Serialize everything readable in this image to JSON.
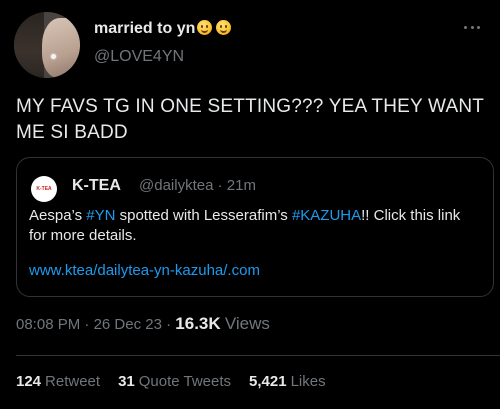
{
  "tweet": {
    "author": {
      "display_name": "married to yn",
      "emojis": [
        "hushed-face",
        "hushed-face"
      ],
      "handle": "@LOVE4YN"
    },
    "text": "MY FAVS TG IN ONE SETTING??? YEA THEY WANT ME SI BADD",
    "quoted": {
      "avatar_text": "K-TEA",
      "display_name": "K-TEA",
      "handle": "@dailyktea",
      "separator": "·",
      "time_ago": "21m",
      "body_parts": {
        "p1": "Aespa’s ",
        "tag1": "#YN",
        "p2": " spotted with Lesserafim’s ",
        "tag2": "#KAZUHA",
        "p3": "!! Click this link for more details."
      },
      "link": "www.ktea/dailytea-yn-kazuha/.com"
    },
    "meta": {
      "time": "08:08 PM",
      "date": "26 Dec 23",
      "separator": "·",
      "views_count": "16.3K",
      "views_label": "Views"
    },
    "stats": {
      "retweets": {
        "count": "124",
        "label": "Retweet"
      },
      "quote_tweets": {
        "count": "31",
        "label": "Quote Tweets"
      },
      "likes": {
        "count": "5,421",
        "label": "Likes"
      }
    }
  },
  "colors": {
    "background": "#000000",
    "text": "#e7e9ea",
    "secondary": "#71767b",
    "link": "#1d9bf0",
    "border": "#2f3336"
  },
  "icons": [
    "more-icon"
  ]
}
